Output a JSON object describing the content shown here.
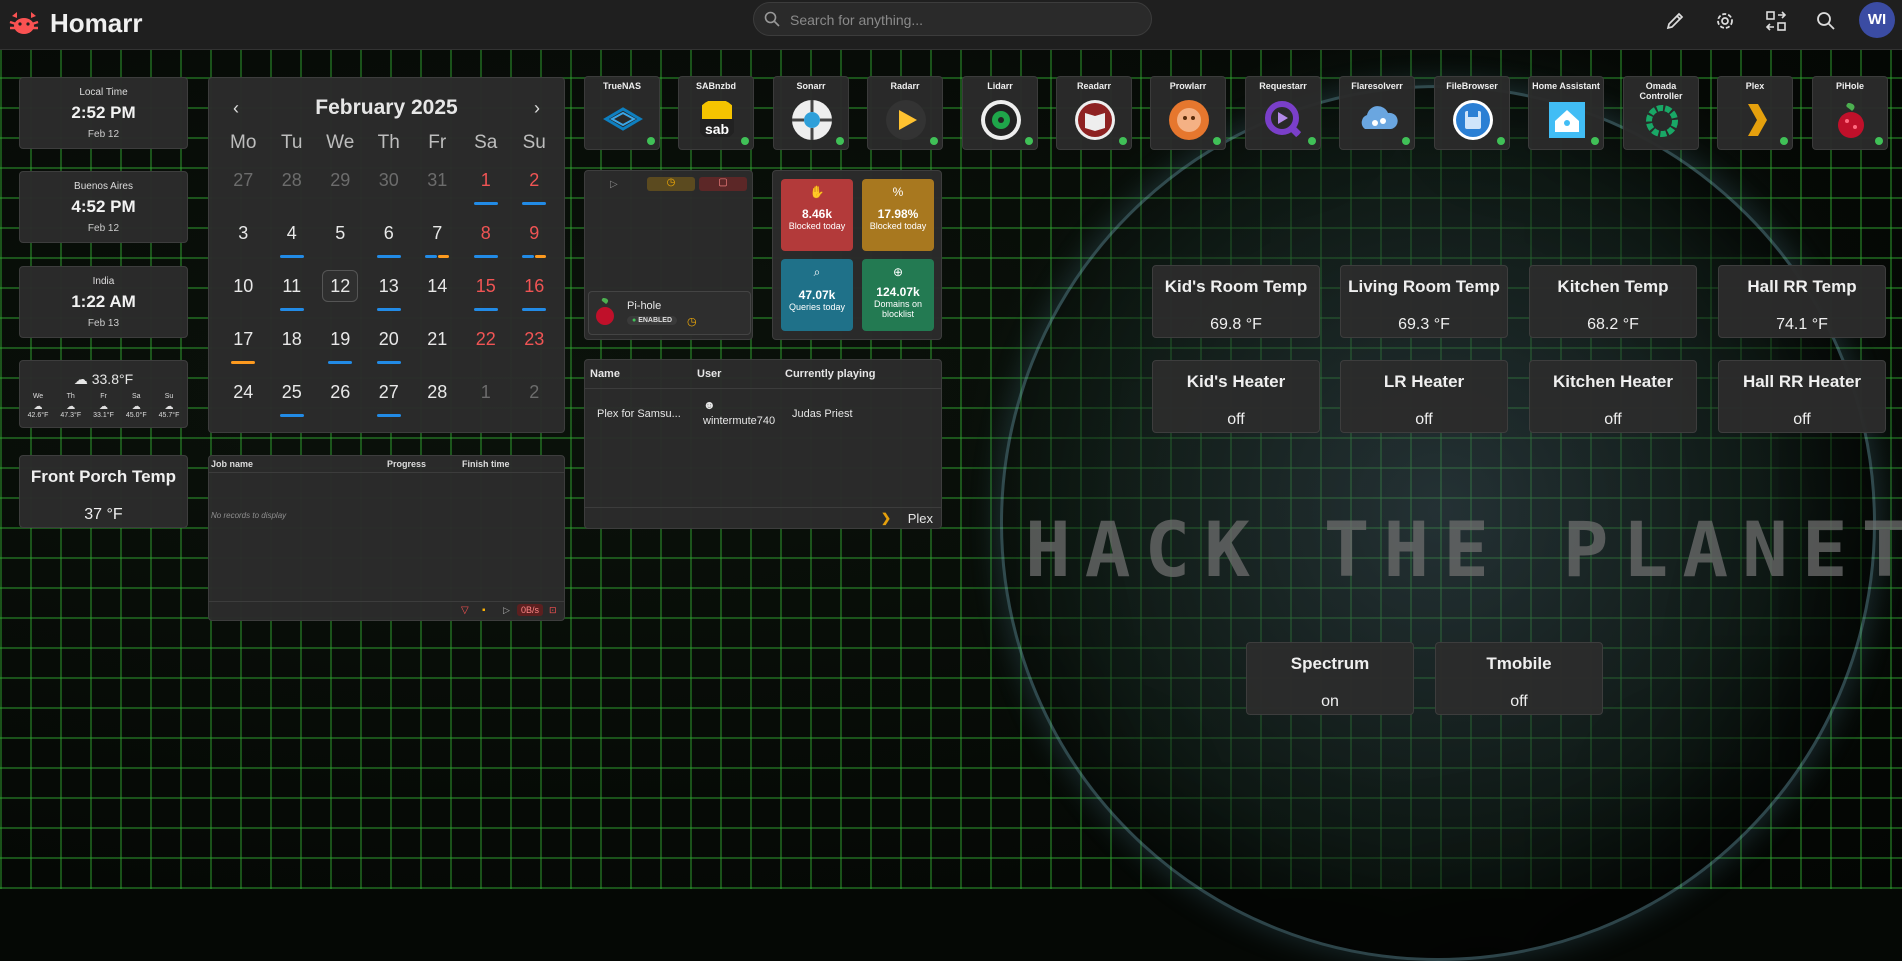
{
  "header": {
    "app_title": "Homarr",
    "search_placeholder": "Search for anything...",
    "avatar_initials": "WI",
    "icons": [
      "logo-icon",
      "pencil-icon",
      "gear-icon",
      "arrows-exchange-icon",
      "search-icon"
    ]
  },
  "clocks": [
    {
      "label": "Local Time",
      "time": "2:52 PM",
      "date": "Feb 12"
    },
    {
      "label": "Buenos Aires",
      "time": "4:52 PM",
      "date": "Feb 12"
    },
    {
      "label": "India",
      "time": "1:22 AM",
      "date": "Feb 13"
    }
  ],
  "weather": {
    "current": "33.8°F",
    "days": [
      {
        "day": "We",
        "temp": "42.6°F"
      },
      {
        "day": "Th",
        "temp": "47.3°F"
      },
      {
        "day": "Fr",
        "temp": "33.1°F"
      },
      {
        "day": "Sa",
        "temp": "45.0°F"
      },
      {
        "day": "Su",
        "temp": "45.7°F"
      }
    ]
  },
  "front_porch": {
    "title": "Front Porch Temp",
    "value": "37 °F"
  },
  "calendar": {
    "title": "February 2025",
    "weekdays": [
      "Mo",
      "Tu",
      "We",
      "Th",
      "Fr",
      "Sa",
      "Su"
    ],
    "weeks": [
      [
        "27",
        "28",
        "29",
        "30",
        "31",
        "1",
        "2"
      ],
      [
        "3",
        "4",
        "5",
        "6",
        "7",
        "8",
        "9"
      ],
      [
        "10",
        "11",
        "12",
        "13",
        "14",
        "15",
        "16"
      ],
      [
        "17",
        "18",
        "19",
        "20",
        "21",
        "22",
        "23"
      ],
      [
        "24",
        "25",
        "26",
        "27",
        "28",
        "1",
        "2"
      ]
    ]
  },
  "downloads": {
    "columns": [
      "Job name",
      "Progress",
      "Finish time"
    ],
    "empty_text": "No records to display",
    "speed": "0B/s"
  },
  "apps": [
    {
      "name": "TrueNAS",
      "icon": "truenas-icon",
      "color": "#0d7fc0"
    },
    {
      "name": "SABnzbd",
      "icon": "sabnzbd-icon",
      "color": "#f5c400"
    },
    {
      "name": "Sonarr",
      "icon": "sonarr-icon",
      "color": "#2e9fd9"
    },
    {
      "name": "Radarr",
      "icon": "radarr-icon",
      "color": "#ffc230"
    },
    {
      "name": "Lidarr",
      "icon": "lidarr-icon",
      "color": "#1fa64a"
    },
    {
      "name": "Readarr",
      "icon": "readarr-icon",
      "color": "#8e2222"
    },
    {
      "name": "Prowlarr",
      "icon": "prowlarr-icon",
      "color": "#e6772e"
    },
    {
      "name": "Requestarr",
      "icon": "requestarr-icon",
      "color": "#7a3fc9"
    },
    {
      "name": "Flaresolverr",
      "icon": "flaresolverr-icon",
      "color": "#6aa6e0"
    },
    {
      "name": "FileBrowser",
      "icon": "filebrowser-icon",
      "color": "#2b7fd4"
    },
    {
      "name": "Home Assistant",
      "icon": "home-assistant-icon",
      "color": "#41bdf5"
    },
    {
      "name": "Omada Controller",
      "icon": "omada-icon",
      "color": "#19a866"
    },
    {
      "name": "Plex",
      "icon": "plex-icon",
      "color": "#e5a00d"
    },
    {
      "name": "PiHole",
      "icon": "pihole-icon",
      "color": "#c0102a"
    }
  ],
  "media_player": {
    "name": "Pi-hole",
    "status": "ENABLED"
  },
  "pihole_stats": [
    {
      "value": "8.46k",
      "label": "Blocked today",
      "color": "#b33a3a",
      "icon": "hand-stop-icon"
    },
    {
      "value": "17.98%",
      "label": "Blocked today",
      "color": "#a8781f",
      "icon": "percentage-icon"
    },
    {
      "value": "47.07k",
      "label": "Queries today",
      "color": "#1f7189",
      "icon": "search-icon"
    },
    {
      "value": "124.07k",
      "label": "Domains on blocklist",
      "color": "#237a52",
      "icon": "globe-icon"
    }
  ],
  "plex": {
    "columns": [
      "Name",
      "User",
      "Currently playing"
    ],
    "row": {
      "name": "Plex for Samsu...",
      "user": "wintermute740",
      "playing": "Judas Priest"
    },
    "footer": "Plex"
  },
  "entities_temp": [
    {
      "title": "Kid's Room Temp",
      "value": "69.8 °F"
    },
    {
      "title": "Living Room Temp",
      "value": "69.3 °F"
    },
    {
      "title": "Kitchen Temp",
      "value": "68.2 °F"
    },
    {
      "title": "Hall RR Temp",
      "value": "74.1 °F"
    }
  ],
  "entities_heater": [
    {
      "title": "Kid's Heater",
      "value": "off"
    },
    {
      "title": "LR Heater",
      "value": "off"
    },
    {
      "title": "Kitchen Heater",
      "value": "off"
    },
    {
      "title": "Hall RR Heater",
      "value": "off"
    }
  ],
  "entities_net": [
    {
      "title": "Spectrum",
      "value": "on"
    },
    {
      "title": "Tmobile",
      "value": "off"
    }
  ],
  "background_text": "HACK THE PLANET"
}
